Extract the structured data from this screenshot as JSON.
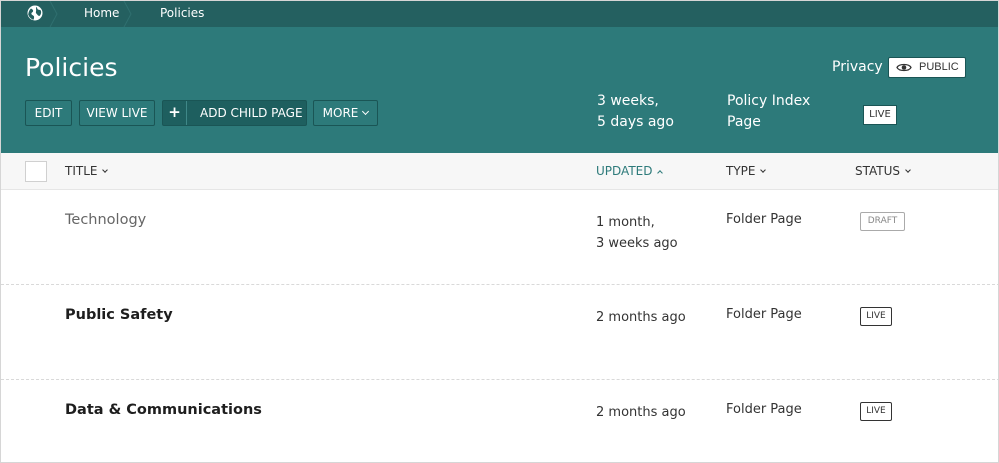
{
  "breadcrumb": {
    "home_icon": "globe-icon",
    "items": [
      "Home",
      "Policies"
    ]
  },
  "header": {
    "title": "Policies",
    "buttons": {
      "edit": "EDIT",
      "view_live": "VIEW LIVE",
      "add_child": "ADD CHILD PAGE",
      "more": "MORE"
    },
    "updated_line1": "3 weeks,",
    "updated_line2": "5 days ago",
    "type_line1": "Policy Index",
    "type_line2": "Page",
    "status": "LIVE",
    "privacy_label": "Privacy",
    "privacy_value": "PUBLIC"
  },
  "columns": {
    "title": "TITLE",
    "updated": "UPDATED",
    "type": "TYPE",
    "status": "STATUS"
  },
  "rows": [
    {
      "title": "Technology",
      "updated_line1": "1 month,",
      "updated_line2": "3 weeks ago",
      "type": "Folder Page",
      "status": "DRAFT"
    },
    {
      "title": "Public Safety",
      "updated_line1": "2 months ago",
      "updated_line2": "",
      "type": "Folder Page",
      "status": "LIVE"
    },
    {
      "title": "Data & Communications",
      "updated_line1": "2 months ago",
      "updated_line2": "",
      "type": "Folder Page",
      "status": "LIVE"
    }
  ],
  "colors": {
    "header_bg": "#2d7a7a",
    "breadcrumb_bg": "#246060",
    "accent": "#2d7a7a"
  }
}
